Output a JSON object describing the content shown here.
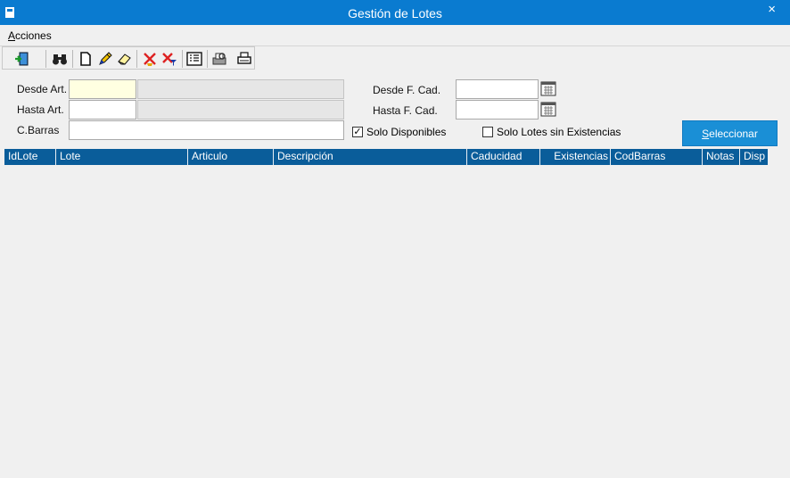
{
  "window": {
    "title": "Gestión de Lotes",
    "close_glyph": "×"
  },
  "menu": {
    "acciones_first": "A",
    "acciones_rest": "cciones"
  },
  "toolbar": {
    "icons": [
      "exit-icon",
      "binoculars-icon",
      "new-doc-icon",
      "edit-pencil-icon",
      "eraser-icon",
      "delete-icon",
      "delete-filter-icon",
      "list-view-icon",
      "print-preview-icon",
      "print-icon"
    ]
  },
  "filters": {
    "desde_art_label": "Desde Art.",
    "hasta_art_label": "Hasta Art.",
    "cbarras_label": "C.Barras",
    "desde_fcad_label": "Desde F. Cad.",
    "hasta_fcad_label": "Hasta F. Cad.",
    "desde_art_value": "",
    "hasta_art_value": "",
    "cbarras_value": "",
    "desde_fcad_value": "",
    "hasta_fcad_value": ""
  },
  "options": {
    "solo_disponibles_label": "Solo Disponibles",
    "solo_disponibles_checked": true,
    "solo_sin_existencias_label": "Solo Lotes sin Existencias",
    "solo_sin_existencias_checked": false,
    "check_mark": "✓"
  },
  "select_button": {
    "underlined": "S",
    "rest": "eleccionar"
  },
  "grid": {
    "columns": [
      "IdLote",
      "Lote",
      "Articulo",
      "Descripción",
      "Caducidad",
      "Existencias",
      "CodBarras",
      "Notas",
      "Disp"
    ],
    "rows": []
  }
}
